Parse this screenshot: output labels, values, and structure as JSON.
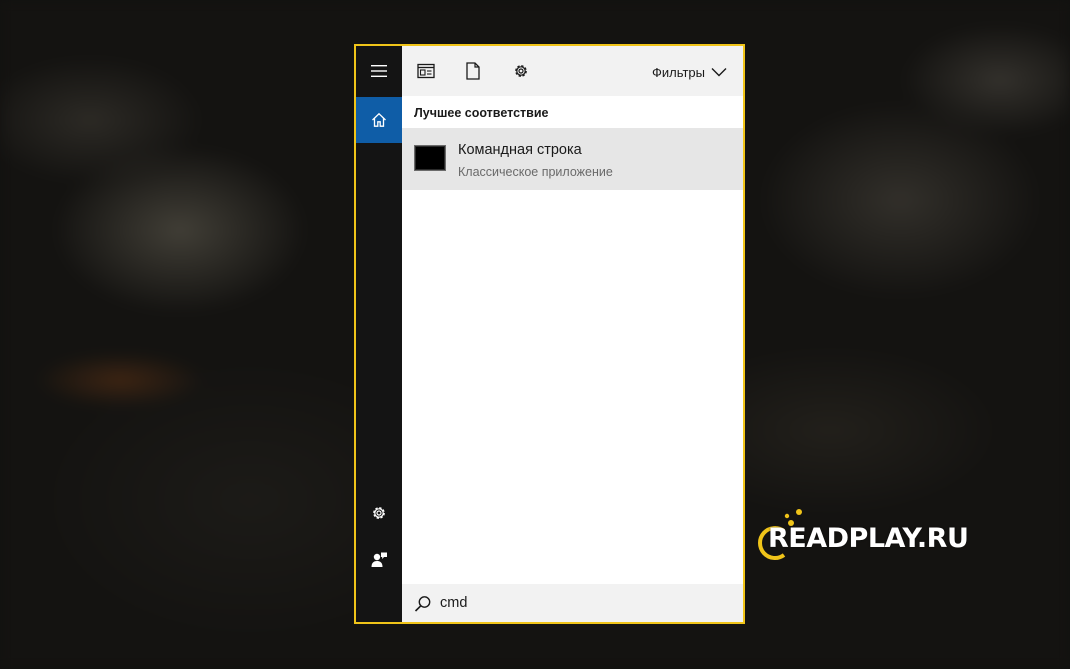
{
  "toolbar": {
    "filters_label": "Фильтры",
    "icons": [
      "apps-icon",
      "document-icon",
      "settings-icon"
    ]
  },
  "results": {
    "section_title": "Лучшее соответствие",
    "best_match": {
      "title": "Командная строка",
      "subtitle": "Классическое приложение"
    }
  },
  "search": {
    "query": "cmd"
  },
  "rail": {
    "items": [
      "menu-icon",
      "home-icon",
      "settings-icon",
      "feedback-icon"
    ]
  },
  "watermark": {
    "text": "READPLAY.RU"
  },
  "colors": {
    "accent": "#0f5da7",
    "highlight_border": "#f0c419",
    "rail_bg": "#141414"
  }
}
